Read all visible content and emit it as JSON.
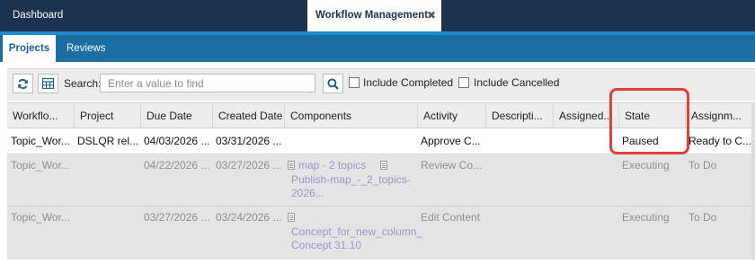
{
  "top_tabs": {
    "dashboard": "Dashboard",
    "active": "Workflow Management",
    "close_glyph": "✖"
  },
  "sub_tabs": {
    "projects": "Projects",
    "reviews": "Reviews"
  },
  "toolbar": {
    "search_label": "Search:",
    "search_placeholder": "Enter a value to find",
    "include_completed": "Include Completed",
    "include_cancelled": "Include Cancelled",
    "include_completed_checked": false,
    "include_cancelled_checked": false
  },
  "columns": [
    "Workflo...",
    "Project",
    "Due Date",
    "Created Date",
    "Components",
    "Activity",
    "Descripti...",
    "Assigned...",
    "State",
    "Assignm..."
  ],
  "rows": [
    {
      "workflow": "Topic_Wor...",
      "project": "DSLQR rel...",
      "due_date": "04/03/2026 ...",
      "created_date": "03/31/2026 ...",
      "components": [],
      "activity": "Approve C...",
      "description": "",
      "assigned": "",
      "state": "Paused",
      "assignment": "Ready to C..."
    },
    {
      "workflow": "Topic_Wor...",
      "project": "",
      "due_date": "04/22/2026 ...",
      "created_date": "03/27/2026 ...",
      "components": [
        "map - 2 topics",
        "Publish-map_-_2_topics-",
        "2026..."
      ],
      "activity": "Review Co...",
      "description": "",
      "assigned": "",
      "state": "Executing",
      "assignment": "To Do"
    },
    {
      "workflow": "Topic_Wor...",
      "project": "",
      "due_date": "03/27/2026 ...",
      "created_date": "03/24/2026 ...",
      "components": [
        "Concept_for_new_column_",
        "Concept 31.10"
      ],
      "activity": "Edit Content",
      "description": "",
      "assigned": "",
      "state": "Executing",
      "assignment": "To Do"
    }
  ],
  "colors": {
    "top_bar": "#1b3350",
    "sub_bar": "#1a6ea1",
    "highlight": "#e0403a",
    "component_link": "#9b95cf"
  }
}
